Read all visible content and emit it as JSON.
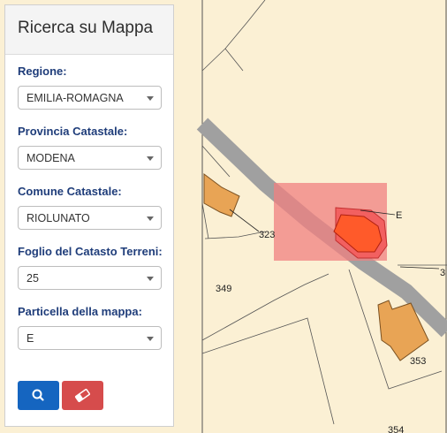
{
  "panel": {
    "title": "Ricerca su Mappa",
    "fields": [
      {
        "label": "Regione:",
        "value": "EMILIA-ROMAGNA"
      },
      {
        "label": "Provincia Catastale:",
        "value": "MODENA"
      },
      {
        "label": "Comune Catastale:",
        "value": "RIOLUNATO"
      },
      {
        "label": "Foglio del Catasto Terreni:",
        "value": "25"
      },
      {
        "label": "Particella della mappa:",
        "value": "E"
      }
    ],
    "search_icon": "search-icon",
    "clear_icon": "eraser-icon"
  },
  "map": {
    "parcel_labels": [
      "323",
      "349",
      "E",
      "353",
      "354",
      "3"
    ],
    "colors": {
      "background": "#fbf0d4",
      "road": "#a0a0a0",
      "building": "#e8a455",
      "highlight": "#f08080",
      "selected_parcel": "#ff5a2a",
      "search_button": "#1565c0",
      "clear_button": "#d64c4c"
    }
  }
}
